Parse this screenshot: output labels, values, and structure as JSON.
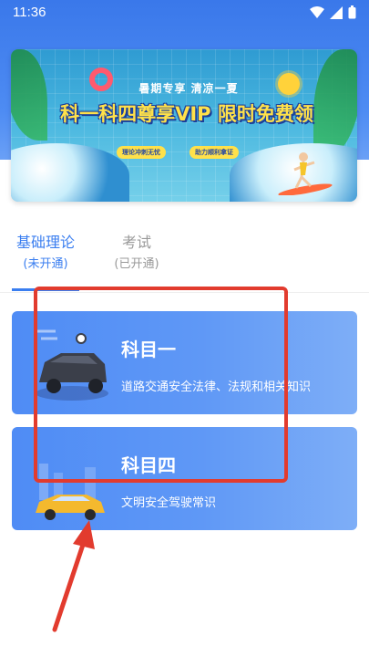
{
  "status_bar": {
    "time": "11:36"
  },
  "banner": {
    "subtitle": "暑期专享  清凉一夏",
    "title": "科一科四尊享VIP 限时免费领",
    "pill_1": "理论冲刺无忧",
    "pill_2": "助力顺利拿证"
  },
  "tabs": [
    {
      "title": "基础理论",
      "subtitle": "(未开通)",
      "active": true
    },
    {
      "title": "考试",
      "subtitle": "(已开通)",
      "active": false
    }
  ],
  "subjects": [
    {
      "title": "科目一",
      "description": "道路交通安全法律、法规和相关知识"
    },
    {
      "title": "科目四",
      "description": "文明安全驾驶常识"
    }
  ],
  "colors": {
    "accent": "#3a7ef0",
    "header": "#3a78ea",
    "card": "#4f8cf5",
    "annotation": "#e23b2e"
  }
}
